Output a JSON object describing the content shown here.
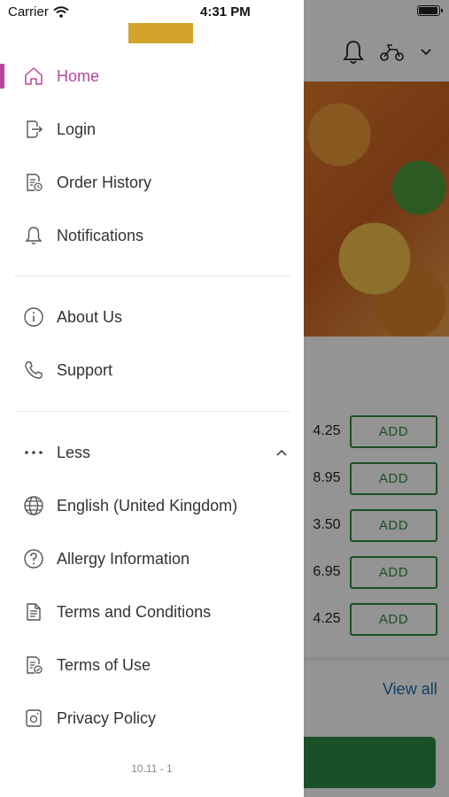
{
  "status_bar": {
    "carrier": "Carrier",
    "time": "4:31 PM"
  },
  "drawer": {
    "section1": [
      {
        "label": "Home",
        "icon": "home-icon",
        "active": true
      },
      {
        "label": "Login",
        "icon": "login-icon"
      },
      {
        "label": "Order History",
        "icon": "order-history-icon"
      },
      {
        "label": "Notifications",
        "icon": "bell-icon"
      }
    ],
    "section2": [
      {
        "label": "About Us",
        "icon": "info-icon"
      },
      {
        "label": "Support",
        "icon": "phone-icon"
      }
    ],
    "section3": [
      {
        "label": "Less",
        "icon": "more-dots-icon"
      },
      {
        "label": "English (United Kingdom)",
        "icon": "globe-icon"
      },
      {
        "label": "Allergy Information",
        "icon": "question-icon"
      },
      {
        "label": "Terms and Conditions",
        "icon": "document-icon"
      },
      {
        "label": "Terms of Use",
        "icon": "document-check-icon"
      },
      {
        "label": "Privacy Policy",
        "icon": "privacy-icon"
      }
    ],
    "version": "10.11 - 1"
  },
  "background": {
    "prices": [
      "4.25",
      "8.95",
      "3.50",
      "6.95",
      "4.25"
    ],
    "add_label": "ADD",
    "view_all": "View all"
  },
  "colors": {
    "accent": "#b5479c",
    "green": "#2f8a3f",
    "logo": "#d3a42c"
  }
}
